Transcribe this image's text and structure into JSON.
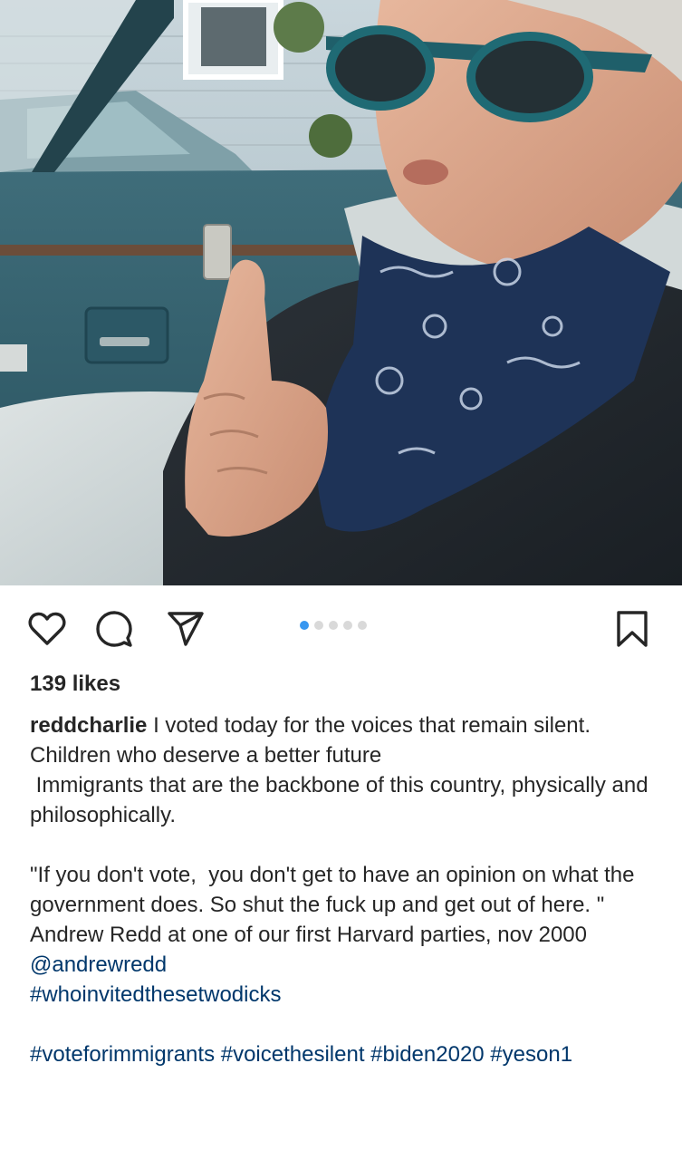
{
  "post": {
    "image_alt": "Selfie of a man in sunglasses and a blue bandana pointing at the camera from a convertible car",
    "carousel": {
      "count": 5,
      "active_index": 0
    },
    "likes": "139 likes",
    "username": "reddcharlie",
    "caption_lines": [
      "I voted today for the voices that remain silent.",
      "Children who deserve a better future",
      " Immigrants that are the backbone of this country, physically and philosophically."
    ],
    "quote": "\"If you don't vote,  you don't get to have an opinion on what the government does. So shut the fuck up and get out of here. \" Andrew Redd at one of our first Harvard parties, nov 2000",
    "mention": "@andrewredd",
    "hashtag_line_1": "#whoinvitedthesetwodicks",
    "hashtag_line_2": "#voteforimmigrants #voicethesilent #biden2020 #yeson1"
  },
  "icons": {
    "like": "heart-icon",
    "comment": "comment-bubble-icon",
    "share": "paper-plane-icon",
    "save": "bookmark-icon"
  },
  "colors": {
    "text": "#262626",
    "link": "#00376b",
    "carousel_active": "#3897f0",
    "carousel_inactive": "#d9d9d9"
  }
}
